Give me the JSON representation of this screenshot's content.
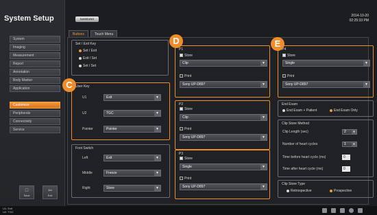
{
  "app": {
    "title": "System Setup"
  },
  "sidebar": {
    "items": [
      {
        "label": "System"
      },
      {
        "label": "Imaging"
      },
      {
        "label": "Measurement"
      },
      {
        "label": "Report"
      },
      {
        "label": "Annotation"
      },
      {
        "label": "Body Marker"
      },
      {
        "label": "Application"
      },
      {
        "label": "Customize",
        "active": true
      },
      {
        "label": "Peripherals"
      },
      {
        "label": "Connectivity"
      },
      {
        "label": "Service"
      }
    ],
    "save_label": "Save",
    "exit_label": "Exit"
  },
  "header": {
    "brand": "SAMSUNG",
    "date": "2014-10-20",
    "time": "02:25:33 PM"
  },
  "tabs": [
    {
      "label": "Buttons",
      "active": true
    },
    {
      "label": "Touch Menu"
    }
  ],
  "set_exit": {
    "title": "Set / Exit Key",
    "options": [
      "Set / Exit",
      "Exit / Set",
      "Set / Set"
    ],
    "selected": 0
  },
  "user_key": {
    "title": "User Key",
    "rows": [
      {
        "label": "U1",
        "value": "Exit"
      },
      {
        "label": "U2",
        "value": "TGC"
      },
      {
        "label": "Pointer",
        "value": "Pointer"
      }
    ]
  },
  "foot_switch": {
    "title": "Foot Switch",
    "rows": [
      {
        "label": "Left",
        "value": "Exit"
      },
      {
        "label": "Middle",
        "value": "Freeze"
      },
      {
        "label": "Right",
        "value": "Store"
      }
    ]
  },
  "p_groups": [
    {
      "title": "P1",
      "store_label": "Store",
      "store_value": "Clip",
      "print_label": "Print",
      "print_value": "Sony UP-D897"
    },
    {
      "title": "P2",
      "store_label": "Store",
      "store_value": "Clip",
      "print_label": "Print",
      "print_value": "Sony UP-D897"
    },
    {
      "title": "P3",
      "store_label": "Store",
      "store_value": "Single",
      "print_label": "Print",
      "print_value": "Sony UP-D897"
    },
    {
      "title": "P4",
      "store_label": "Store",
      "store_value": "Single",
      "print_label": "Print",
      "print_value": "Sony UP-D897"
    }
  ],
  "end_exam": {
    "title": "End Exam",
    "options": [
      "End Exam + Patient",
      "End Exam Only"
    ],
    "selected": 1
  },
  "clip_store": {
    "title": "Clip Store Method",
    "rows": [
      {
        "label": "Clip Length (sec)",
        "value": "2"
      },
      {
        "label": "Number of heart cycles",
        "value": "1"
      },
      {
        "label": "Time before heart cycle (ms)",
        "value": "0"
      },
      {
        "label": "Time after heart cycle (ms)",
        "value": "0"
      }
    ]
  },
  "clip_store_type": {
    "title": "Clip Store Type",
    "options": [
      "Retrospective",
      "Prospective"
    ],
    "selected": 1
  },
  "callouts": [
    "C",
    "D",
    "E"
  ],
  "bottom": {
    "line1": "U1: Exit",
    "line2": "U2: TGC"
  },
  "colors": {
    "accent": "#f08c2a",
    "background": "#1b1d20"
  }
}
